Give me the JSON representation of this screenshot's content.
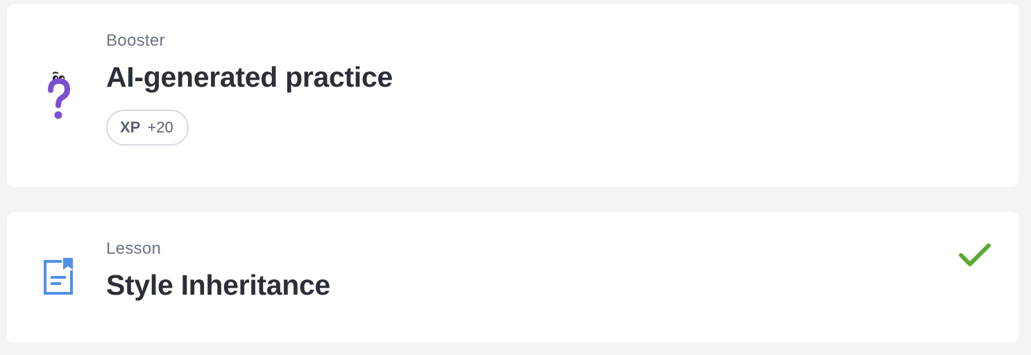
{
  "items": [
    {
      "type_label": "Booster",
      "title": "AI-generated practice",
      "icon": "question-mark-icon",
      "xp": {
        "label": "XP",
        "value": "+20"
      }
    },
    {
      "type_label": "Lesson",
      "title": "Style Inheritance",
      "icon": "document-bookmark-icon",
      "status": "completed"
    }
  ],
  "colors": {
    "background": "#f3f4f6",
    "card": "#ffffff",
    "booster_icon": "#7b4fd1",
    "lesson_icon": "#4f8fe8",
    "check": "#5aa832",
    "title": "#2b2f38",
    "muted": "#6b7385"
  }
}
